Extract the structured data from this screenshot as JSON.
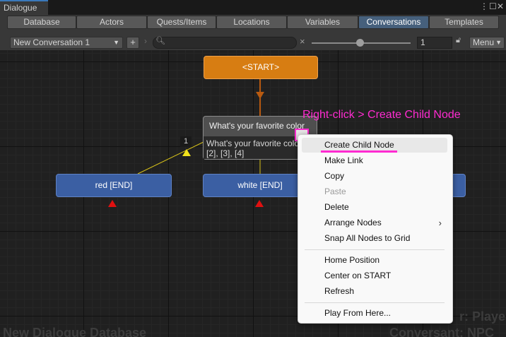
{
  "window": {
    "tab_title": "Dialogue",
    "more_icon": "kebab-menu",
    "max_icon": "maximize",
    "close_icon": "close"
  },
  "nav": {
    "tabs": [
      "Database",
      "Actors",
      "Quests/Items",
      "Locations",
      "Variables",
      "Conversations",
      "Templates"
    ],
    "active": "Conversations"
  },
  "subtoolbar": {
    "conversation_select": "New Conversation 1",
    "add_label": "+",
    "search_value": "",
    "clear_label": "×",
    "zoom_value": "1",
    "menu_label": "Menu"
  },
  "canvas": {
    "start_node": "<START>",
    "question_node": {
      "title": "What's your favorite color",
      "line1": "What's your favorite color",
      "line2": "[2], [3], [4]"
    },
    "response_badge": "1",
    "node_red": "red [END]",
    "node_white": "white [END]",
    "watermark_left": "New Dialogue Database",
    "watermark_right1": "r: Player",
    "watermark_right2": "Conversant: NPC",
    "annotation": "Right-click > Create Child Node",
    "colors": {
      "accent": "#ff2bd1",
      "start_node": "#d77d12",
      "blue_node": "#3b5fa3"
    }
  },
  "context_menu": {
    "items": [
      {
        "label": "Create Child Node"
      },
      {
        "label": "Make Link"
      },
      {
        "label": "Copy"
      },
      {
        "label": "Paste"
      },
      {
        "label": "Delete"
      },
      {
        "label": "Arrange Nodes"
      },
      {
        "label": "Snap All Nodes to Grid"
      },
      {
        "label": "Home Position"
      },
      {
        "label": "Center on START"
      },
      {
        "label": "Refresh"
      },
      {
        "label": "Play From Here..."
      }
    ]
  }
}
